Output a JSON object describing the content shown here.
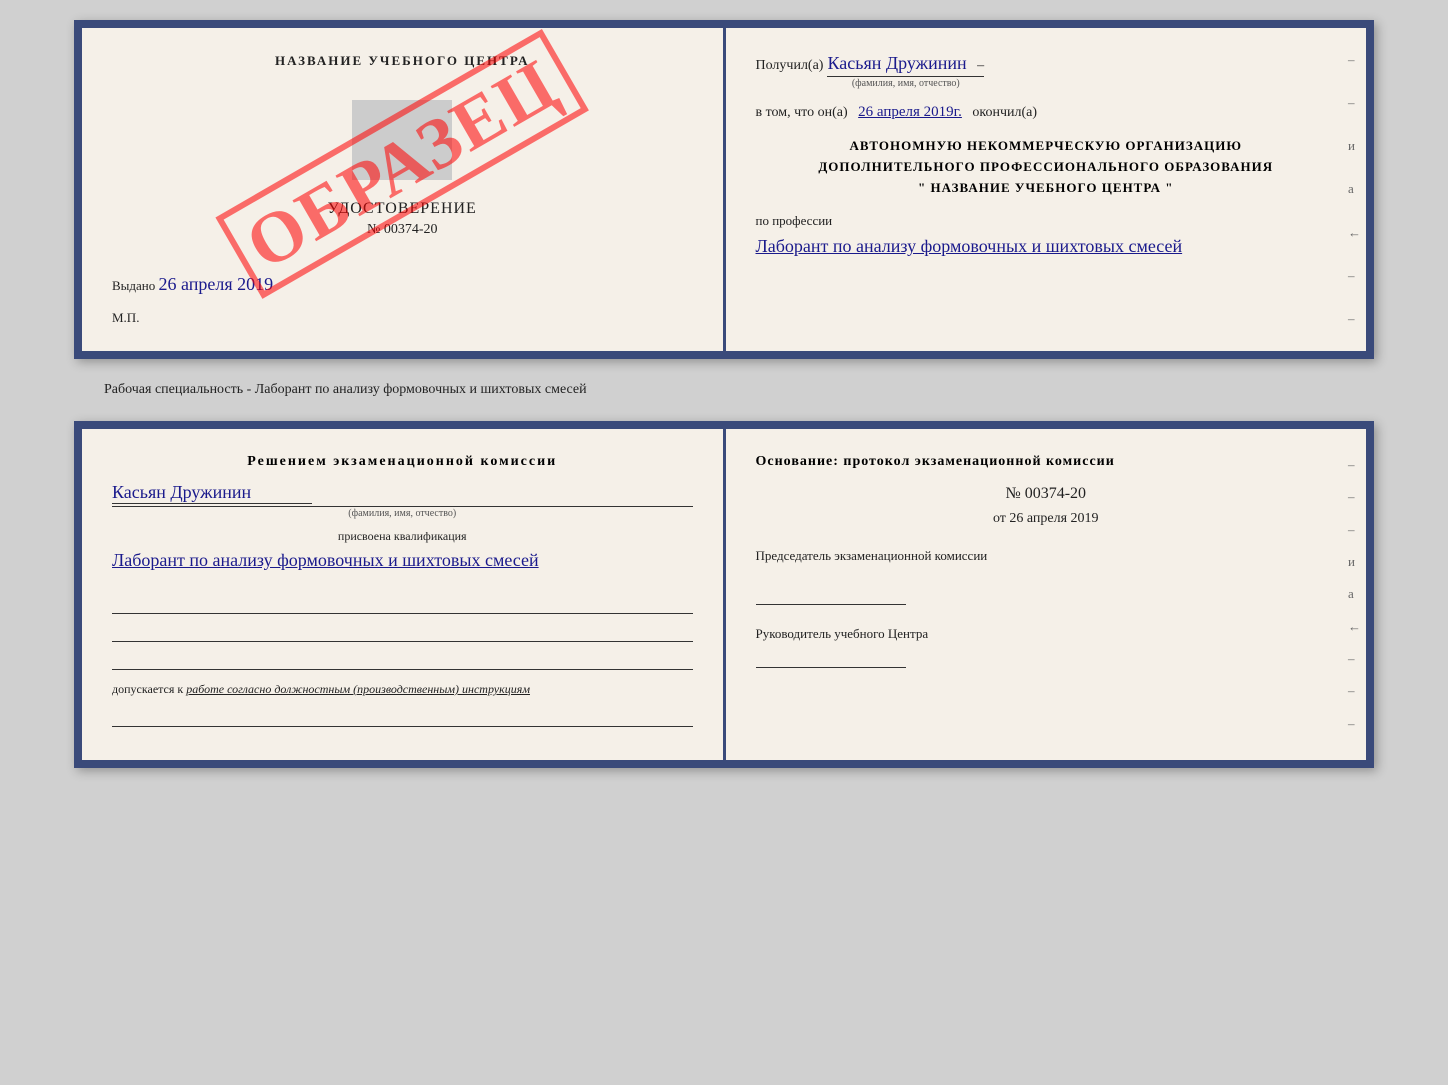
{
  "top_cert": {
    "left": {
      "title": "НАЗВАНИЕ УЧЕБНОГО ЦЕНТРА",
      "obrazets": "ОБРАЗЕЦ",
      "udostoverenie": "УДОСТОВЕРЕНИЕ",
      "number": "№ 00374-20",
      "vydano": "Выдано",
      "vydano_date": "26 апреля 2019",
      "mp": "М.П."
    },
    "right": {
      "poluchil_label": "Получил(а)",
      "fio": "Касьян Дружинин",
      "fio_subtitle": "(фамилия, имя, отчество)",
      "vtom_label": "в том, что он(а)",
      "date": "26 апреля 2019г.",
      "okonchil": "окончил(а)",
      "org_line1": "АВТОНОМНУЮ НЕКОММЕРЧЕСКУЮ ОРГАНИЗАЦИЮ",
      "org_line2": "ДОПОЛНИТЕЛЬНОГО ПРОФЕССИОНАЛЬНОГО ОБРАЗОВАНИЯ",
      "org_line3": "\" НАЗВАНИЕ УЧЕБНОГО ЦЕНТРА \"",
      "po_professii": "по профессии",
      "profession": "Лаборант по анализу формовочных и шихтовых смесей"
    }
  },
  "specialty_line": "Рабочая специальность - Лаборант по анализу формовочных и шихтовых смесей",
  "bottom_cert": {
    "left": {
      "resheniem": "Решением экзаменационной комиссии",
      "fio": "Касьян Дружинин",
      "fio_subtitle": "(фамилия, имя, отчество)",
      "prisvoena": "присвоена квалификация",
      "qualification": "Лаборант по анализу формовочных и шихтовых смесей",
      "dopuskaetsya_label": "допускается к",
      "dopuskaetsya_text": "работе согласно должностным (производственным) инструкциям"
    },
    "right": {
      "osnovanie": "Основание: протокол экзаменационной комиссии",
      "number": "№ 00374-20",
      "ot_label": "от",
      "date": "26 апреля 2019",
      "predsedatel_label": "Председатель экзаменационной комиссии",
      "rukov_label": "Руководитель учебного Центра"
    }
  }
}
